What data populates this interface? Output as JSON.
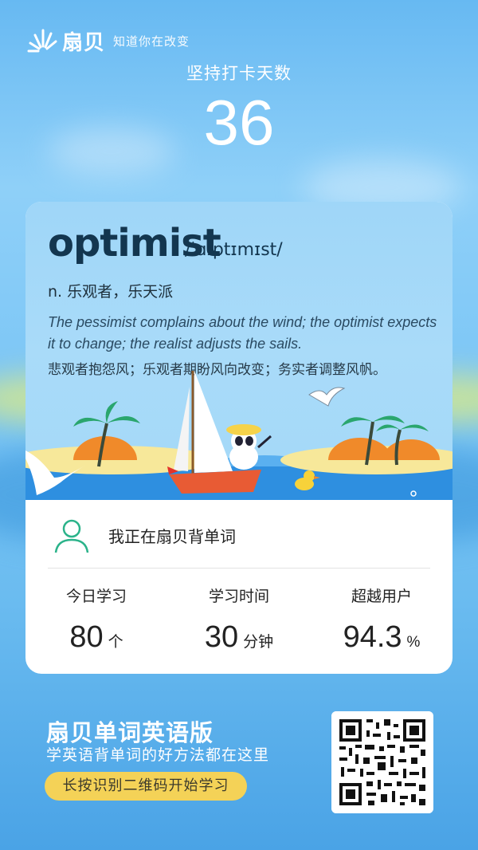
{
  "brand": {
    "name": "扇贝",
    "slogan": "知道你在改变"
  },
  "streak": {
    "label": "坚持打卡天数",
    "days": "36"
  },
  "word_card": {
    "word": "optimist",
    "phonetic": "/ˈɑːptɪmɪst/",
    "definition": "n. 乐观者，乐天派",
    "example_en": "The pessimist complains about the wind; the optimist expects it to change; the realist adjusts the sails.",
    "example_zh": "悲观者抱怨风；乐观者期盼风向改变；务实者调整风帆。"
  },
  "user_status": "我正在扇贝背单词",
  "stats": [
    {
      "label": "今日学习",
      "value": "80",
      "unit": "个"
    },
    {
      "label": "学习时间",
      "value": "30",
      "unit": "分钟"
    },
    {
      "label": "超越用户",
      "value": "94.3",
      "unit": "%"
    }
  ],
  "footer": {
    "title": "扇贝单词英语版",
    "subtitle": "学英语背单词的好方法都在这里",
    "cta": "长按识别二维码开始学习"
  },
  "colors": {
    "accent_green": "#2bb38a",
    "cta_yellow": "#f4d257",
    "word_dark": "#13364f"
  }
}
